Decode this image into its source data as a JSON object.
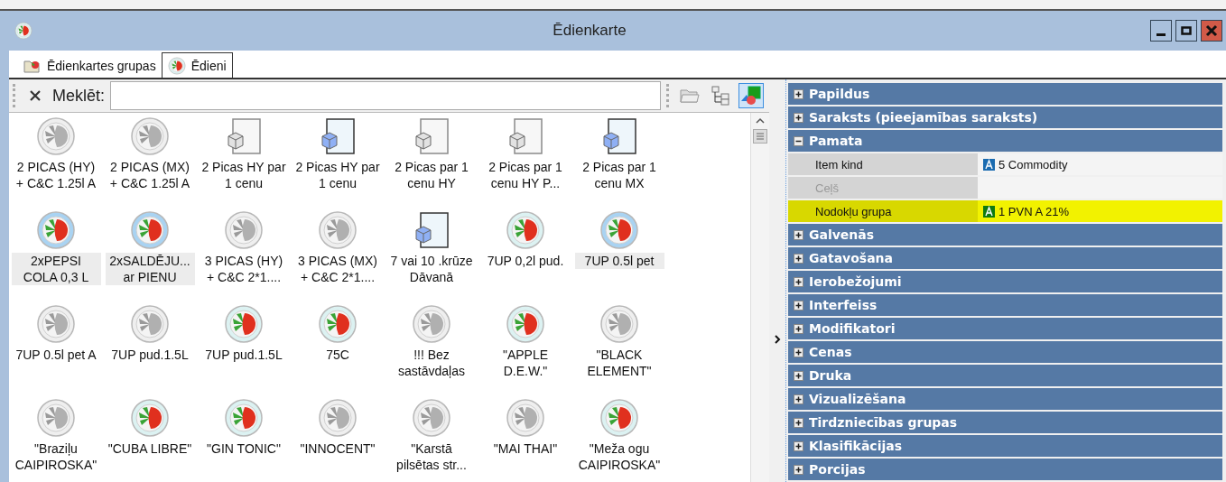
{
  "window": {
    "title": "Ēdienkarte"
  },
  "tabs": [
    {
      "label": "Ēdienkartes grupas",
      "selected": false
    },
    {
      "label": "Ēdieni",
      "selected": true
    }
  ],
  "search": {
    "label": "Meklēt:"
  },
  "toolbar_buttons": [
    {
      "kind": "folder",
      "selected": false
    },
    {
      "kind": "tree",
      "selected": false
    },
    {
      "kind": "shapes",
      "selected": true
    }
  ],
  "items": [
    {
      "label": "2 PICAS (HY) + C&C 1.25l A",
      "kind": "dish",
      "active": false,
      "selected": false
    },
    {
      "label": "2 PICAS (MX) + C&C 1.25l A",
      "kind": "dish",
      "active": false,
      "selected": false
    },
    {
      "label": "2 Picas HY par 1 cenu",
      "kind": "box",
      "active": false,
      "selected": false
    },
    {
      "label": "2 Picas HY par 1 cenu",
      "kind": "box",
      "active": true,
      "selected": false
    },
    {
      "label": "2 Picas par 1 cenu HY",
      "kind": "box",
      "active": false,
      "selected": false
    },
    {
      "label": "2 Picas par 1 cenu HY P...",
      "kind": "box",
      "active": false,
      "selected": false
    },
    {
      "label": "2 Picas par 1 cenu MX",
      "kind": "box",
      "active": true,
      "selected": false
    },
    {
      "label": "2xPEPSI COLA 0,3 L",
      "kind": "dish",
      "active": true,
      "selected": true
    },
    {
      "label": "2xSALDĒJU... ar PIENU",
      "kind": "dish",
      "active": true,
      "selected": true
    },
    {
      "label": "3 PICAS (HY) + C&C 2*1....",
      "kind": "dish",
      "active": false,
      "selected": false
    },
    {
      "label": "3 PICAS (MX) + C&C 2*1....",
      "kind": "dish",
      "active": false,
      "selected": false
    },
    {
      "label": "7 vai 10 .krūze Dāvanā",
      "kind": "box",
      "active": true,
      "selected": false
    },
    {
      "label": "7UP 0,2l pud.",
      "kind": "dish",
      "active": true,
      "selected": false
    },
    {
      "label": "7UP 0.5l pet",
      "kind": "dish",
      "active": true,
      "selected": true
    },
    {
      "label": "7UP 0.5l pet A",
      "kind": "dish",
      "active": false,
      "selected": false
    },
    {
      "label": "7UP pud.1.5L",
      "kind": "dish",
      "active": false,
      "selected": false
    },
    {
      "label": "7UP pud.1.5L",
      "kind": "dish",
      "active": true,
      "selected": false
    },
    {
      "label": "75C",
      "kind": "dish",
      "active": true,
      "selected": false
    },
    {
      "label": "!!! Bez sastāvdaļas",
      "kind": "dish",
      "active": false,
      "selected": false
    },
    {
      "label": "\"APPLE D.E.W.\"",
      "kind": "dish",
      "active": true,
      "selected": false
    },
    {
      "label": "\"BLACK ELEMENT\"",
      "kind": "dish",
      "active": false,
      "selected": false
    },
    {
      "label": "\"Braziļu CAIPIROSKA\"",
      "kind": "dish",
      "active": false,
      "selected": false
    },
    {
      "label": "\"CUBA LIBRE\"",
      "kind": "dish",
      "active": true,
      "selected": false
    },
    {
      "label": "\"GIN TONIC\"",
      "kind": "dish",
      "active": true,
      "selected": false
    },
    {
      "label": "\"INNOCENT\"",
      "kind": "dish",
      "active": false,
      "selected": false
    },
    {
      "label": "\"Karstā pilsētas str...",
      "kind": "dish",
      "active": false,
      "selected": false
    },
    {
      "label": "\"MAI THAI\"",
      "kind": "dish",
      "active": false,
      "selected": false
    },
    {
      "label": "\"Meža ogu CAIPIROSKA\"",
      "kind": "dish",
      "active": true,
      "selected": false
    }
  ],
  "properties": [
    {
      "title": "Papildus",
      "expanded": false
    },
    {
      "title": "Saraksts (pieejamības saraksts)",
      "expanded": false
    },
    {
      "title": "Pamata",
      "expanded": true,
      "rows": [
        {
          "name": "Item kind",
          "value": "5 Commodity",
          "color": "#1a6bb0",
          "disabled": false,
          "highlighted": false
        },
        {
          "name": "Ceļš",
          "disabled": true,
          "highlighted": false
        },
        {
          "name": "Nodokļu grupa",
          "value": "1 PVN A 21%",
          "color": "#107a10",
          "disabled": false,
          "highlighted": true
        }
      ]
    },
    {
      "title": "Galvenās",
      "expanded": false
    },
    {
      "title": "Gatavošana",
      "expanded": false
    },
    {
      "title": "Ierobežojumi",
      "expanded": false
    },
    {
      "title": "Interfeiss",
      "expanded": false
    },
    {
      "title": "Modifikatori",
      "expanded": false
    },
    {
      "title": "Cenas",
      "expanded": false
    },
    {
      "title": "Druka",
      "expanded": false
    },
    {
      "title": "Vizualizēšana",
      "expanded": false
    },
    {
      "title": "Tirdzniecības grupas",
      "expanded": false
    },
    {
      "title": "Klasifikācijas",
      "expanded": false
    },
    {
      "title": "Porcijas",
      "expanded": false
    }
  ]
}
